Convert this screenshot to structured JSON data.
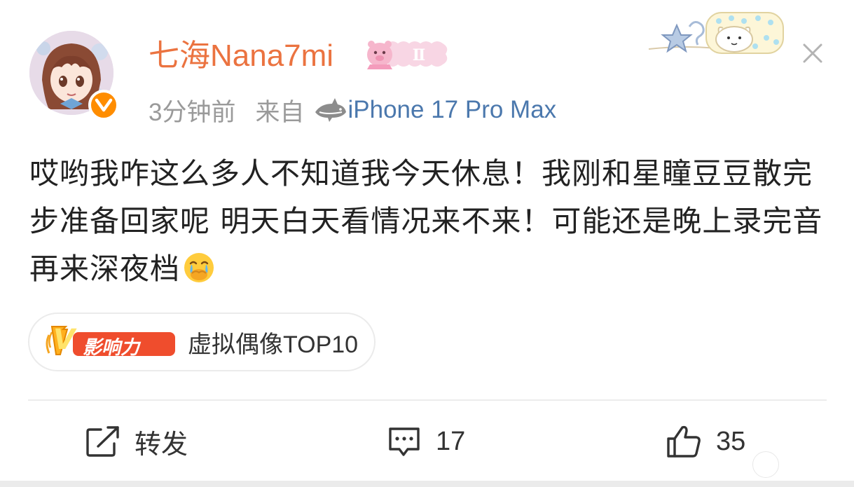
{
  "post": {
    "author": {
      "name": "七海Nana7mi",
      "verified_icon": "verified-v-icon",
      "level_badge_icon": "pig-ii-badge-icon",
      "name_color": "#eb7340"
    },
    "meta": {
      "time": "3分钟前",
      "from_label": "来自",
      "device": "iPhone 17 Pro Max",
      "device_color": "#4b78ad"
    },
    "text": "哎哟我咋这么多人不知道我今天休息！我刚和星瞳豆豆散完步准备回家呢 明天白天看情况来不来！可能还是晚上录完音再来深夜档",
    "text_emoji": "crying-covering-mouth-emoji",
    "tag": {
      "logo_v": "V",
      "logo_text": "影响力",
      "label": "虚拟偶像TOP10"
    },
    "actions": {
      "repost_label": "转发",
      "comment_count": "17",
      "like_count": "35"
    }
  },
  "colors": {
    "accent_orange": "#ff8d00",
    "text_main": "#222222",
    "meta_gray": "#9a9a9a"
  }
}
